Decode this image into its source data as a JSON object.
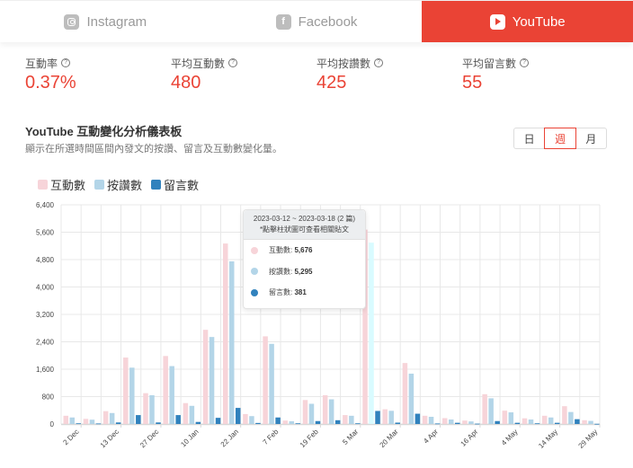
{
  "tabs": [
    {
      "label": "Instagram",
      "icon": "instagram-icon",
      "active": false
    },
    {
      "label": "Facebook",
      "icon": "facebook-icon",
      "active": false
    },
    {
      "label": "YouTube",
      "icon": "youtube-icon",
      "active": true
    }
  ],
  "stats": [
    {
      "label": "互動率",
      "value": "0.37%"
    },
    {
      "label": "平均互動數",
      "value": "480"
    },
    {
      "label": "平均按讚數",
      "value": "425"
    },
    {
      "label": "平均留言數",
      "value": "55"
    }
  ],
  "help_glyph": "?",
  "section": {
    "title": "YouTube 互動變化分析儀表板",
    "description": "顯示在所選時間區間內發文的按讚、留言及互動數變化量。"
  },
  "period": {
    "options": [
      "日",
      "週",
      "月"
    ],
    "selected": "週"
  },
  "tooltip": {
    "range": "2023-03-12 ~ 2023-03-18 (2 篇)",
    "hint": "*點擊柱狀圖可查看相關貼文",
    "rows": [
      {
        "label": "互動數:",
        "value": "5,676"
      },
      {
        "label": "按讚數:",
        "value": "5,295"
      },
      {
        "label": "留言數:",
        "value": "381"
      }
    ]
  },
  "colors": {
    "accent": "#ea4335",
    "interactions": "#f7d4d9",
    "likes": "#b3d5e8",
    "comments": "#3182bd",
    "highlight": "#d9fbff"
  },
  "chart_data": {
    "type": "bar",
    "title": "YouTube 互動變化分析儀表板",
    "xlabel": "",
    "ylabel": "",
    "ylim": [
      0,
      6400
    ],
    "yticks": [
      0,
      800,
      1600,
      2400,
      3200,
      4000,
      4800,
      5600,
      6400
    ],
    "ytick_labels": [
      "0",
      "800",
      "1,600",
      "2,400",
      "3,200",
      "4,000",
      "4,800",
      "5,600",
      "6,400"
    ],
    "grid": true,
    "legend": "top-left",
    "xtick_labels": [
      "2 Dec",
      "13 Dec",
      "27 Dec",
      "10 Jan",
      "22 Jan",
      "7 Feb",
      "19 Feb",
      "5 Mar",
      "20 Mar",
      "4 Apr",
      "16 Apr",
      "4 May",
      "14 May",
      "29 May"
    ],
    "highlighted_index": 15,
    "categories_count": 27,
    "series": [
      {
        "name": "互動數",
        "color": "#f7d4d9",
        "values": [
          240,
          150,
          375,
          1940,
          900,
          1985,
          610,
          2750,
          5270,
          290,
          2560,
          100,
          700,
          840,
          260,
          5676,
          430,
          1780,
          240,
          170,
          100,
          870,
          390,
          165,
          240,
          520,
          110
        ]
      },
      {
        "name": "按讚數",
        "color": "#b3d5e8",
        "values": [
          190,
          125,
          320,
          1645,
          840,
          1690,
          530,
          2540,
          4750,
          230,
          2340,
          80,
          590,
          720,
          240,
          5295,
          385,
          1470,
          210,
          130,
          75,
          750,
          340,
          130,
          190,
          350,
          90
        ]
      },
      {
        "name": "留言數",
        "color": "#3182bd",
        "values": [
          20,
          15,
          45,
          260,
          45,
          260,
          60,
          180,
          470,
          30,
          190,
          20,
          85,
          110,
          20,
          381,
          40,
          300,
          15,
          35,
          10,
          85,
          35,
          20,
          35,
          140,
          5
        ]
      }
    ]
  }
}
